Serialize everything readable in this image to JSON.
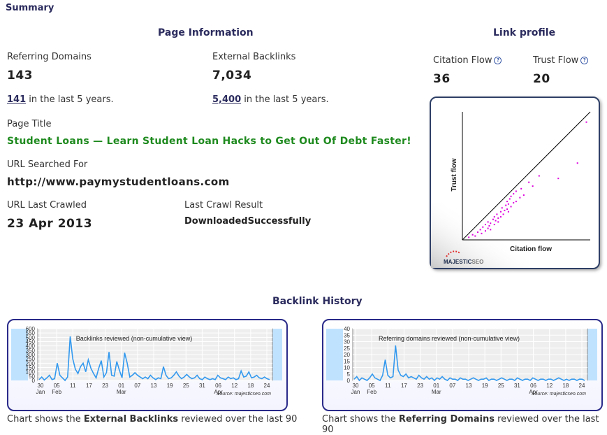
{
  "summary_label": "Summary",
  "page_info": {
    "heading": "Page Information",
    "referring_domains_label": "Referring Domains",
    "referring_domains_value": "143",
    "referring_domains_recent": "141",
    "recent_suffix": " in the last 5 years.",
    "external_backlinks_label": "External Backlinks",
    "external_backlinks_value": "7,034",
    "external_backlinks_recent": "5,400",
    "page_title_label": "Page Title",
    "page_title_value": "Student Loans — Learn Student Loan Hacks to Get Out Of Debt Faster!",
    "url_searched_label": "URL Searched For",
    "url_searched_value": "http://www.paymystudentloans.com",
    "url_crawled_label": "URL Last Crawled",
    "url_crawled_value": "23 Apr 2013",
    "last_crawl_result_label": "Last Crawl Result",
    "last_crawl_result_value": "DownloadedSuccessfully"
  },
  "link_profile": {
    "heading": "Link profile",
    "citation_flow_label": "Citation Flow",
    "citation_flow_value": "36",
    "trust_flow_label": "Trust Flow",
    "trust_flow_value": "20",
    "info_glyph": "?",
    "chart_ylabel": "Trust flow",
    "chart_xlabel": "Citation flow",
    "brand_majestic": "MAJESTIC",
    "brand_seo": "SEO",
    "point_color": "#dd00dd"
  },
  "backlink_history": {
    "heading": "Backlink History",
    "caption1_prefix": "Chart shows the ",
    "caption1_bold": "External Backlinks",
    "caption1_suffix": " reviewed over the last 90",
    "caption2_prefix": "Chart shows the ",
    "caption2_bold": "Referring Domains",
    "caption2_suffix": " reviewed over the last 90",
    "line_color": "#3399ee"
  },
  "chart_data": [
    {
      "type": "scatter",
      "title": "",
      "xlabel": "Citation flow",
      "ylabel": "Trust flow",
      "series": [
        {
          "x": [
            5,
            8,
            10,
            12,
            14,
            15,
            16,
            18,
            18,
            20,
            20,
            21,
            22,
            22,
            24,
            25,
            25,
            26,
            27,
            28,
            28,
            30,
            30,
            31,
            32,
            33,
            34,
            35,
            35,
            36,
            36,
            37,
            38,
            38,
            40,
            40,
            42,
            42,
            45,
            46,
            48,
            52,
            55,
            60,
            75,
            90,
            97
          ],
          "y": [
            2,
            4,
            3,
            6,
            8,
            5,
            10,
            7,
            12,
            9,
            14,
            11,
            8,
            13,
            16,
            12,
            18,
            15,
            20,
            17,
            14,
            22,
            18,
            25,
            20,
            23,
            27,
            24,
            30,
            22,
            28,
            32,
            26,
            34,
            29,
            36,
            30,
            38,
            33,
            40,
            35,
            45,
            42,
            50,
            48,
            60,
            92
          ]
        }
      ],
      "xlim": [
        0,
        100
      ],
      "ylim": [
        0,
        100
      ]
    },
    {
      "type": "line",
      "title": "Backlinks reviewed (non-cumulative view)",
      "xlabel": "",
      "ylabel": "",
      "y_ticks": [
        "0",
        "50",
        "100",
        "150",
        "200",
        "250",
        "300",
        "350",
        "400",
        "450",
        "500",
        "550",
        "600"
      ],
      "x_ticks": [
        "30",
        "05",
        "11",
        "17",
        "23",
        "01",
        "07",
        "13",
        "19",
        "25",
        "31",
        "06",
        "12",
        "18",
        "24"
      ],
      "x_month_labels": [
        "Jan",
        "Feb",
        "Mar",
        "Apr"
      ],
      "source": "Source: majesticseo.com",
      "ylim": [
        0,
        600
      ],
      "values": [
        10,
        40,
        5,
        30,
        60,
        10,
        20,
        200,
        60,
        30,
        0,
        40,
        510,
        250,
        130,
        80,
        160,
        200,
        100,
        240,
        140,
        80,
        30,
        140,
        230,
        40,
        90,
        330,
        60,
        50,
        220,
        120,
        30,
        320,
        200,
        40,
        60,
        90,
        60,
        40,
        20,
        40,
        20,
        60,
        30,
        10,
        30,
        20,
        160,
        60,
        20,
        30,
        60,
        100,
        50,
        20,
        40,
        70,
        40,
        20,
        30,
        60,
        20,
        10,
        40,
        20,
        10,
        20,
        10,
        60,
        30,
        20,
        10,
        40,
        20,
        30,
        10,
        20,
        110,
        40,
        50,
        100,
        30,
        40,
        60,
        30,
        20,
        40,
        20,
        10
      ]
    },
    {
      "type": "line",
      "title": "Referring domains reviewed (non-cumulative view)",
      "xlabel": "",
      "ylabel": "",
      "y_ticks": [
        "0",
        "5",
        "10",
        "15",
        "20",
        "25",
        "30",
        "35",
        "40"
      ],
      "x_ticks": [
        "30",
        "05",
        "11",
        "17",
        "23",
        "01",
        "07",
        "13",
        "19",
        "25",
        "31",
        "06",
        "12",
        "18",
        "24"
      ],
      "x_month_labels": [
        "Jan",
        "Feb",
        "Mar",
        "Apr"
      ],
      "source": "Source: majesticseo.com",
      "ylim": [
        0,
        40
      ],
      "values": [
        1,
        3,
        0,
        2,
        1,
        0,
        2,
        5,
        2,
        1,
        0,
        4,
        16,
        4,
        2,
        3,
        27,
        8,
        4,
        3,
        5,
        2,
        3,
        2,
        1,
        4,
        2,
        1,
        3,
        1,
        2,
        0,
        2,
        1,
        3,
        1,
        0,
        2,
        1,
        1,
        0,
        2,
        1,
        1,
        0,
        1,
        2,
        1,
        0,
        1,
        1,
        2,
        0,
        1,
        1,
        0,
        1,
        2,
        1,
        0,
        1,
        1,
        0,
        2,
        1,
        0,
        1,
        1,
        0,
        2,
        1,
        0,
        1,
        1,
        0,
        1,
        1,
        0,
        1,
        2,
        1,
        0,
        1,
        0,
        1,
        1,
        0,
        1,
        1,
        0
      ]
    }
  ]
}
